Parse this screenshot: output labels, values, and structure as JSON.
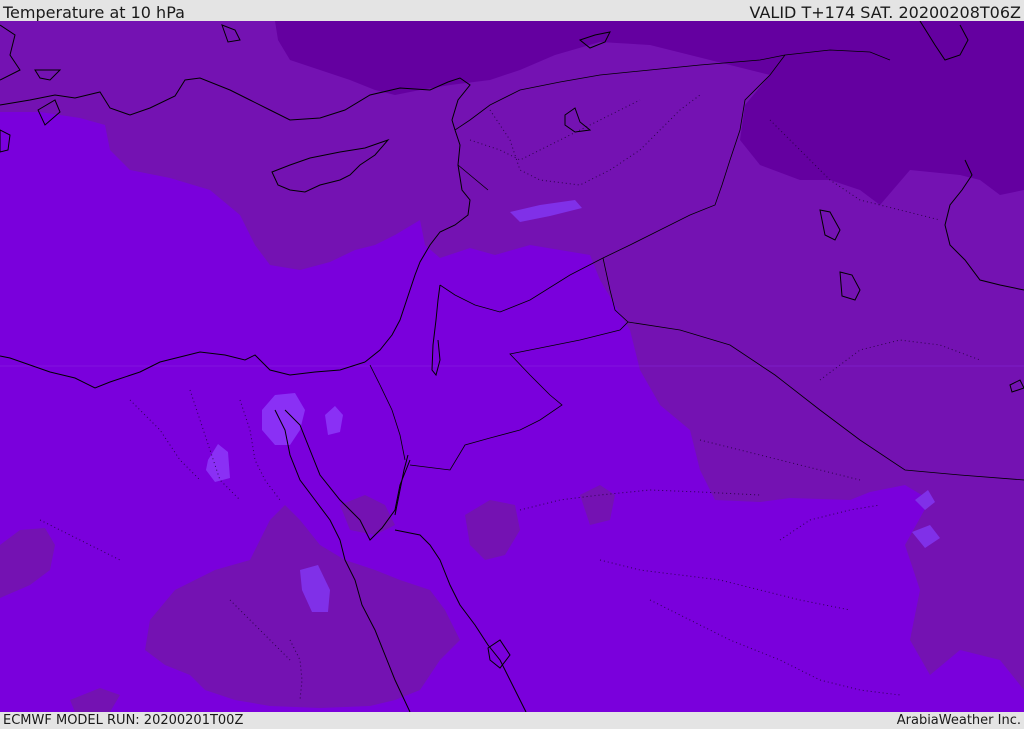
{
  "header": {
    "title": "Temperature at 10 hPa",
    "valid": "VALID T+174 SAT. 20200208T06Z"
  },
  "footer": {
    "model_run": "ECMWF MODEL RUN: 20200201T00Z",
    "credit": "ArabiaWeather Inc."
  },
  "map": {
    "variable": "temperature",
    "level": "10 hPa",
    "palette": {
      "deep_violet": "#6400a0",
      "dark_purple": "#7412b2",
      "purple": "#7a00dc",
      "light_violet": "#8a30f5",
      "border_line": "#000000"
    }
  }
}
